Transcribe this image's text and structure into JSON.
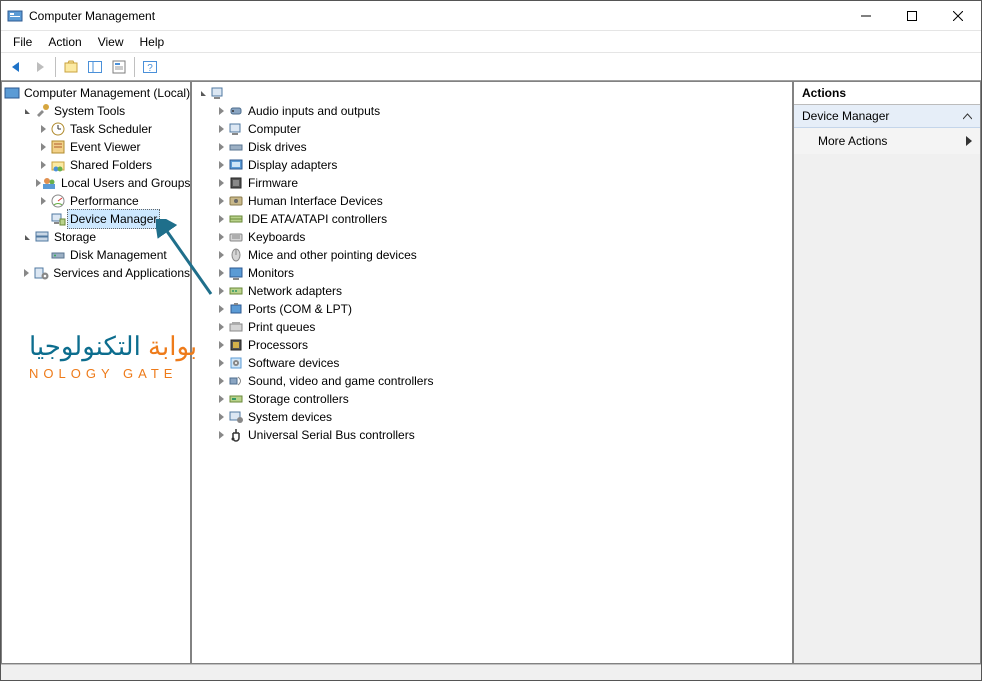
{
  "window": {
    "title": "Computer Management"
  },
  "menus": {
    "file": "File",
    "action": "Action",
    "view": "View",
    "help": "Help"
  },
  "left_tree": {
    "root": "Computer Management (Local)",
    "system_tools": "System Tools",
    "task_scheduler": "Task Scheduler",
    "event_viewer": "Event Viewer",
    "shared_folders": "Shared Folders",
    "local_users": "Local Users and Groups",
    "performance": "Performance",
    "device_manager": "Device Manager",
    "storage": "Storage",
    "disk_management": "Disk Management",
    "services_apps": "Services and Applications"
  },
  "devices": [
    "Audio inputs and outputs",
    "Computer",
    "Disk drives",
    "Display adapters",
    "Firmware",
    "Human Interface Devices",
    "IDE ATA/ATAPI controllers",
    "Keyboards",
    "Mice and other pointing devices",
    "Monitors",
    "Network adapters",
    "Ports (COM & LPT)",
    "Print queues",
    "Processors",
    "Software devices",
    "Sound, video and game controllers",
    "Storage controllers",
    "System devices",
    "Universal Serial Bus controllers"
  ],
  "actions": {
    "header": "Actions",
    "section": "Device Manager",
    "more": "More Actions"
  },
  "watermark": {
    "line1_a": "بوابة ",
    "line1_b": "التكنولوجيا",
    "line2": "NOLOGY GATE"
  }
}
